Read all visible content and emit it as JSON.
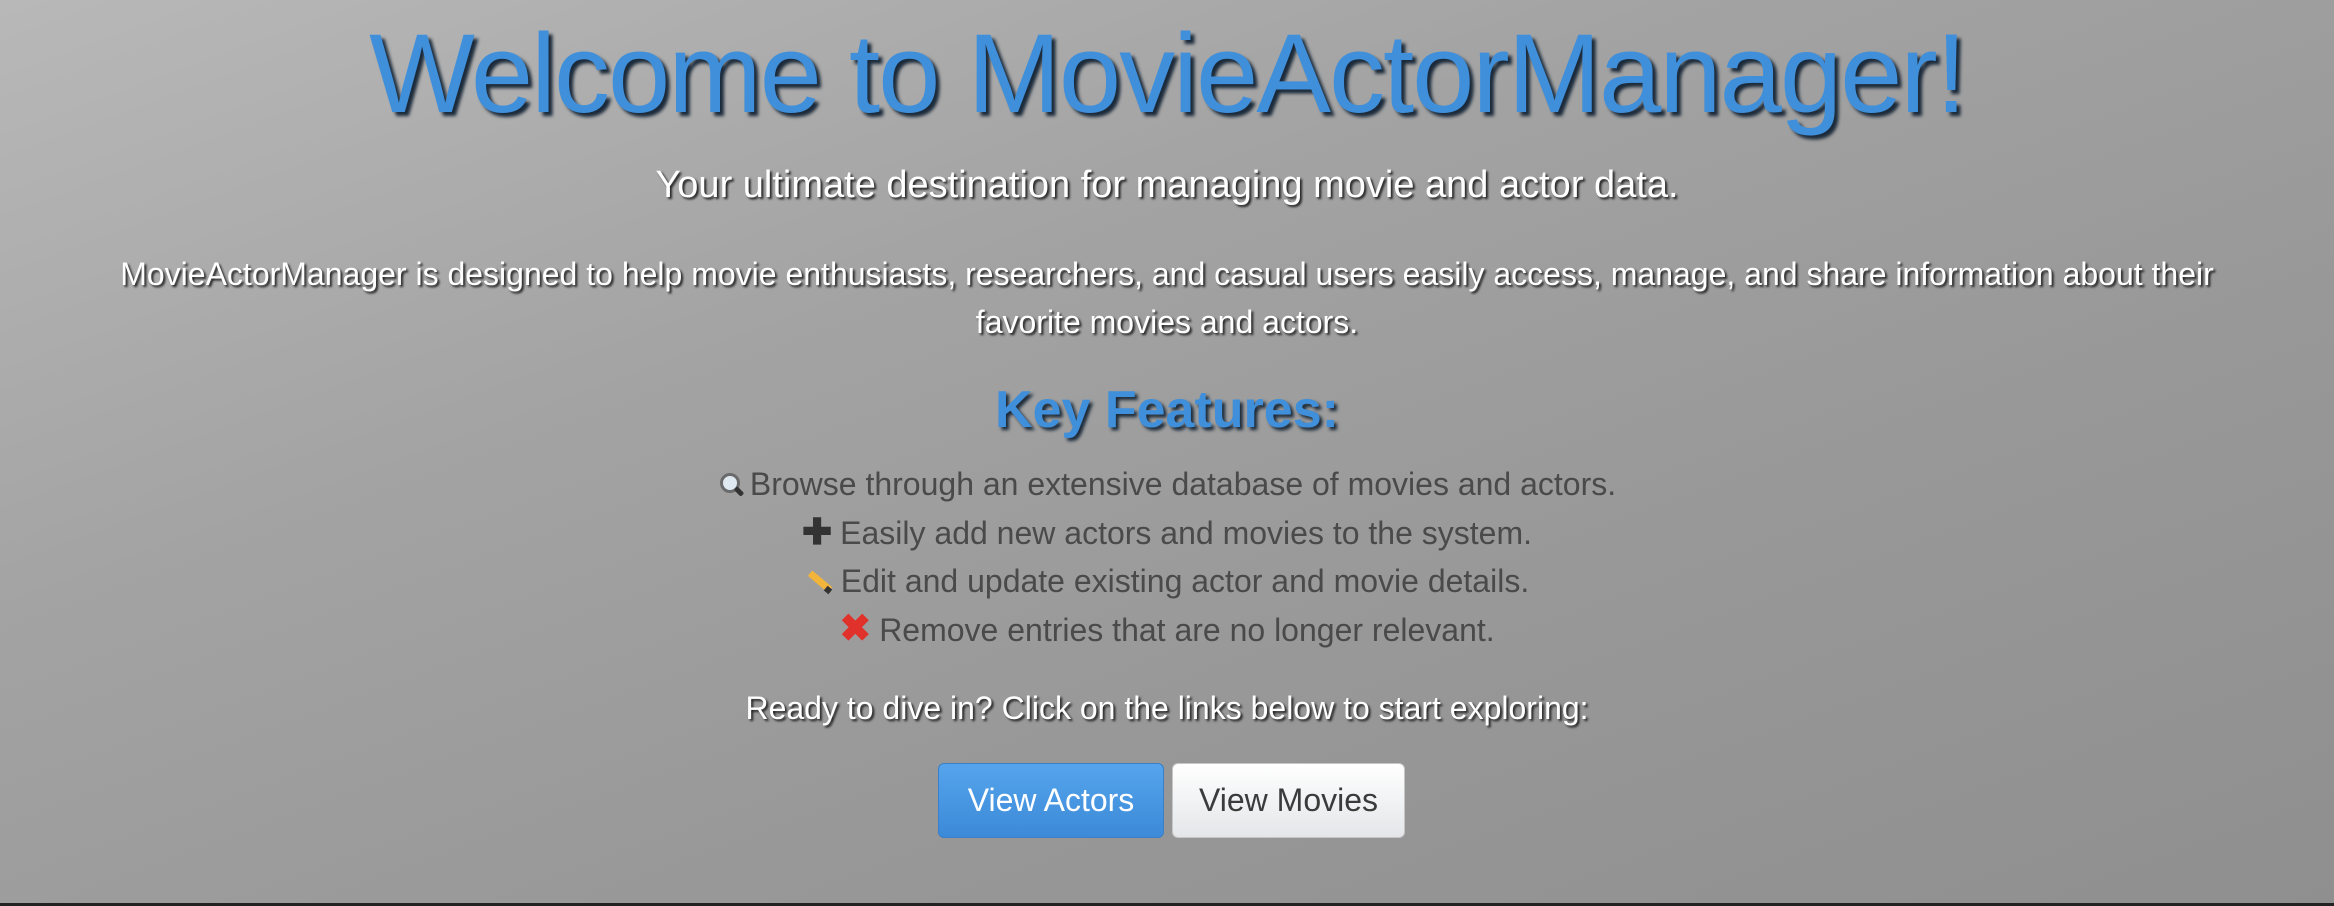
{
  "hero": {
    "title": "Welcome to MovieActorManager!",
    "subtitle": "Your ultimate destination for managing movie and actor data.",
    "description": "MovieActorManager is designed to help movie enthusiasts, researchers, and casual users easily access, manage, and share information about their favorite movies and actors."
  },
  "features": {
    "heading": "Key Features:",
    "items": [
      {
        "icon": "magnifying-glass-icon",
        "text": "Browse through an extensive database of movies and actors."
      },
      {
        "icon": "plus-icon",
        "text": "Easily add new actors and movies to the system."
      },
      {
        "icon": "pencil-icon",
        "text": "Edit and update existing actor and movie details."
      },
      {
        "icon": "cross-mark-icon",
        "text": "Remove entries that are no longer relevant."
      }
    ]
  },
  "cta": {
    "text": "Ready to dive in? Click on the links below to start exploring:",
    "actors_button": "View Actors",
    "movies_button": "View Movies"
  },
  "colors": {
    "accent": "#3f8fdb",
    "primary_button": "#4a98e3",
    "delete_icon": "#e0322b"
  }
}
